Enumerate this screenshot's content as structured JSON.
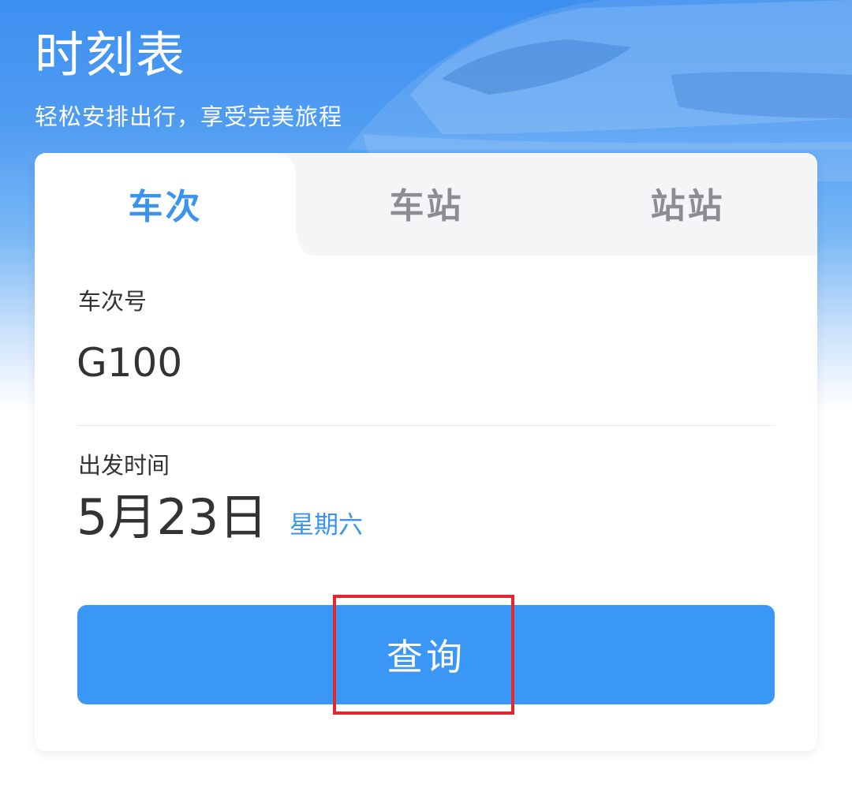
{
  "header": {
    "title": "时刻表",
    "subtitle": "轻松安排出行，享受完美旅程"
  },
  "tabs": [
    {
      "label": "车次",
      "active": true
    },
    {
      "label": "车站",
      "active": false
    },
    {
      "label": "站站",
      "active": false
    }
  ],
  "form": {
    "train_number": {
      "label": "车次号",
      "value": "G100"
    },
    "departure": {
      "label": "出发时间",
      "date": "5月23日",
      "weekday": "星期六"
    },
    "search_button": {
      "label": "查询"
    }
  },
  "colors": {
    "accent": "#3b93ee",
    "button": "#3b97f5",
    "highlight": "#e0282e",
    "header_blue": "#3d8ff0"
  }
}
